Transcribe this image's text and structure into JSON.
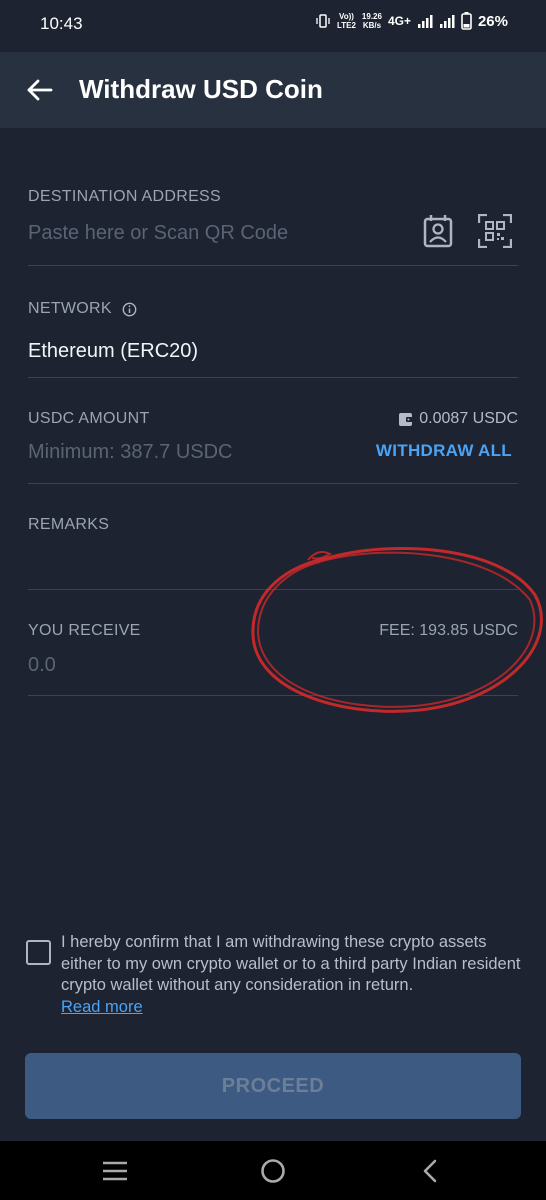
{
  "status_bar": {
    "time": "10:43",
    "volte": "Vo))",
    "lte": "LTE2",
    "speed_value": "19.26",
    "speed_unit": "KB/s",
    "network": "4G+",
    "battery": "26%"
  },
  "header": {
    "title": "Withdraw USD Coin",
    "back_icon": "arrow-left-icon"
  },
  "destination": {
    "label": "DESTINATION ADDRESS",
    "placeholder": "Paste here or Scan QR Code",
    "contact_icon": "contact-book-icon",
    "qr_icon": "qr-scan-icon"
  },
  "network": {
    "label": "NETWORK",
    "value": "Ethereum (ERC20)",
    "info_icon": "info-icon"
  },
  "amount": {
    "label": "USDC AMOUNT",
    "placeholder": "Minimum: 387.7 USDC",
    "balance": "0.0087 USDC",
    "withdraw_all": "WITHDRAW ALL"
  },
  "remarks": {
    "label": "REMARKS"
  },
  "receive": {
    "label": "YOU RECEIVE",
    "value": "0.0",
    "fee": "FEE: 193.85 USDC"
  },
  "confirm": {
    "text": "I hereby confirm that I am withdrawing these crypto assets either to my own crypto wallet or to a third party Indian resident crypto wallet without any consideration in return.",
    "read_more": "Read more",
    "checked": false
  },
  "proceed": {
    "label": "PROCEED"
  },
  "colors": {
    "background": "#1d2330",
    "header": "#28313f",
    "accent": "#4aa3f5",
    "button": "#3c5a82",
    "annotation": "#d42a2a"
  }
}
